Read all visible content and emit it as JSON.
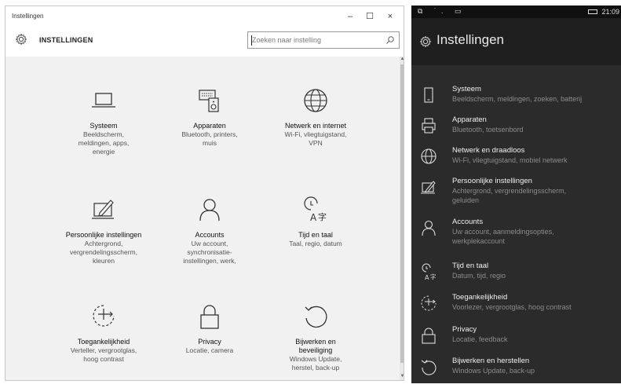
{
  "desktop": {
    "window_title": "Instellingen",
    "controls": {
      "minimize": "–",
      "maximize": "☐",
      "close": "×"
    },
    "heading": "INSTELLINGEN",
    "search": {
      "placeholder": "Zoeken naar instelling",
      "icon": "search-icon"
    },
    "tiles": [
      {
        "icon": "laptop-icon",
        "name": "Systeem",
        "description": "Beeldscherm,\nmeldingen, apps,\nenergie"
      },
      {
        "icon": "keyboard-speaker-icon",
        "name": "Apparaten",
        "description": "Bluetooth, printers,\nmuis"
      },
      {
        "icon": "globe-icon",
        "name": "Netwerk en internet",
        "description": "Wi-Fi, vliegtuigstand,\nVPN"
      },
      {
        "icon": "pen-screen-icon",
        "name": "Persoonlijke instellingen",
        "description": "Achtergrond,\nvergrendelingsscherm,\nkleuren"
      },
      {
        "icon": "person-icon",
        "name": "Accounts",
        "description": "Uw account,\nsynchronisatie-\ninstellingen, werk,"
      },
      {
        "icon": "time-language-icon",
        "name": "Tijd en taal",
        "description": "Taal, regio, datum"
      },
      {
        "icon": "accessibility-icon",
        "name": "Toegankelijkheid",
        "description": "Verteller, vergrootglas,\nhoog contrast"
      },
      {
        "icon": "lock-icon",
        "name": "Privacy",
        "description": "Locatie, camera"
      },
      {
        "icon": "refresh-icon",
        "name": "Bijwerken en\nbeveiliging",
        "description": "Windows Update,\nherstel, back-up"
      }
    ]
  },
  "phone": {
    "status": {
      "icons": "⧉ ˙. ▭",
      "time": "21:09"
    },
    "title": "Instellingen",
    "items": [
      {
        "icon": "phone-device-icon",
        "name": "Systeem",
        "description": "Beeldscherm, meldingen, zoeken, batterij"
      },
      {
        "icon": "printer-icon",
        "name": "Apparaten",
        "description": "Bluetooth, toetsenbord"
      },
      {
        "icon": "globe-icon",
        "name": "Netwerk en draadloos",
        "description": "Wi-Fi, vliegtuigstand, mobiel netwerk"
      },
      {
        "icon": "pen-screen-icon",
        "name": "Persoonlijke instellingen",
        "description": "Achtergrond, vergrendelingsscherm,\ngeluiden"
      },
      {
        "icon": "person-icon",
        "name": "Accounts",
        "description": "Uw account, aanmeldingsopties,\nwerkplekaccount"
      },
      {
        "icon": "time-language-icon",
        "name": "Tijd en taal",
        "description": "Datum, tijd, regio"
      },
      {
        "icon": "accessibility-icon",
        "name": "Toegankelijkheid",
        "description": "Voorlezer, vergrootglas, hoog contrast"
      },
      {
        "icon": "lock-icon",
        "name": "Privacy",
        "description": "Locatie, feedback"
      },
      {
        "icon": "refresh-icon",
        "name": "Bijwerken en herstellen",
        "description": "Windows Update, back-up"
      }
    ]
  },
  "colors": {
    "desktop_bg": "#f1f1f1",
    "phone_bg": "#2b2b2b",
    "phone_text": "#f0f0f0",
    "phone_subtext": "#8c8c8c"
  }
}
